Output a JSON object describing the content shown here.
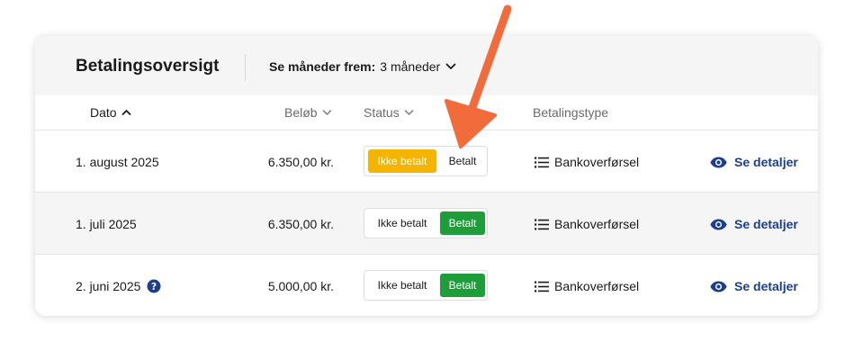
{
  "header": {
    "title": "Betalingsoversigt",
    "months_label": "Se måneder frem:",
    "months_value": "3 måneder"
  },
  "columns": {
    "date": "Dato",
    "amount": "Beløb",
    "status": "Status",
    "type": "Betalingstype"
  },
  "rows": [
    {
      "date": "1. august 2025",
      "amount": "6.350,00 kr.",
      "status": "Ikke betalt",
      "opt_unpaid": "Ikke betalt",
      "opt_paid": "Betalt",
      "type": "Bankoverførsel",
      "details": "Se detaljer",
      "help_icon": false
    },
    {
      "date": "1. juli 2025",
      "amount": "6.350,00 kr.",
      "status": "Betalt",
      "opt_unpaid": "Ikke betalt",
      "opt_paid": "Betalt",
      "type": "Bankoverførsel",
      "details": "Se detaljer",
      "help_icon": false
    },
    {
      "date": "2. juni 2025",
      "amount": "5.000,00 kr.",
      "status": "Betalt",
      "opt_unpaid": "Ikke betalt",
      "opt_paid": "Betalt",
      "type": "Bankoverførsel",
      "details": "Se detaljer",
      "help_icon": true
    }
  ],
  "icons": {
    "sort_active": "chevron-up-icon",
    "sort": "chevron-down-icon",
    "dropdown": "chevron-down-icon",
    "help": "question-circle-icon",
    "payment_type": "list-icon",
    "details": "eye-icon",
    "annotation": "arrow-annotation"
  },
  "colors": {
    "unpaid_active": "#f5b400",
    "paid_active": "#1f9d3b",
    "link": "#1d3e8a",
    "annotation_arrow": "#f26b3a",
    "header_bg": "#f5f5f5"
  }
}
